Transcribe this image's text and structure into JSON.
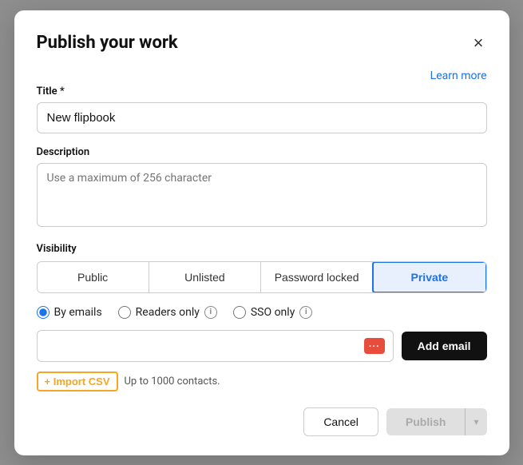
{
  "modal": {
    "title": "Publish your work",
    "close_label": "×",
    "learn_more_label": "Learn more",
    "title_field": {
      "label": "Title *",
      "value": "New flipbook",
      "placeholder": "New flipbook"
    },
    "description_field": {
      "label": "Description",
      "placeholder": "Use a maximum of 256 character"
    },
    "visibility": {
      "label": "Visibility",
      "tabs": [
        {
          "key": "public",
          "label": "Public",
          "active": false
        },
        {
          "key": "unlisted",
          "label": "Unlisted",
          "active": false
        },
        {
          "key": "password_locked",
          "label": "Password locked",
          "active": false
        },
        {
          "key": "private",
          "label": "Private",
          "active": true
        }
      ]
    },
    "private_options": {
      "radios": [
        {
          "key": "by_emails",
          "label": "By emails",
          "checked": true
        },
        {
          "key": "readers_only",
          "label": "Readers only",
          "checked": false,
          "has_info": true
        },
        {
          "key": "sso_only",
          "label": "SSO only",
          "checked": false,
          "has_info": true
        }
      ]
    },
    "email_input_placeholder": "",
    "add_email_btn_label": "Add email",
    "import_csv_label": "+ Import CSV",
    "import_note": "Up to 1000 contacts.",
    "cancel_btn_label": "Cancel",
    "publish_btn_label": "Publish",
    "dropdown_arrow": "▾"
  }
}
